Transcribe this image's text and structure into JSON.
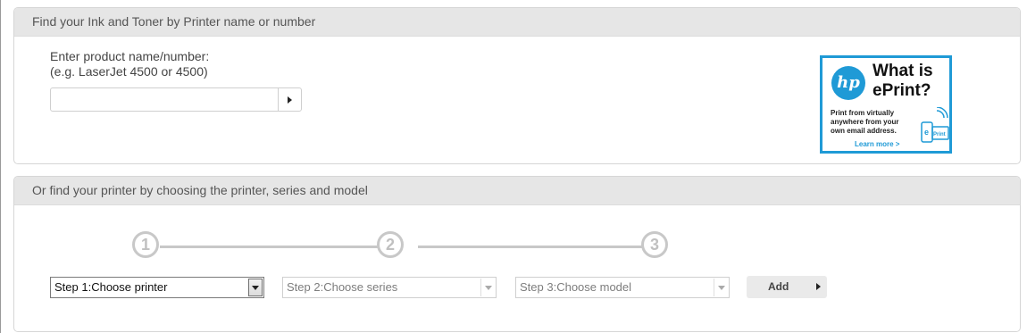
{
  "search_panel": {
    "title": "Find your Ink and Toner by Printer name or number",
    "label_line1": "Enter product name/number:",
    "label_line2": "(e.g. LaserJet 4500 or 4500)",
    "input_value": "",
    "input_placeholder": ""
  },
  "eprint_ad": {
    "logo_text": "hp",
    "headline_line1": "What is",
    "headline_line2": "ePrint?",
    "body_line1": "Print from virtually",
    "body_line2": "anywhere from your",
    "body_line3": "own email address.",
    "link": "Learn more >",
    "device_badge": "Print",
    "brand_color": "#1f9ad6"
  },
  "finder_panel": {
    "title": "Or find your printer by choosing the printer, series and model",
    "steps": [
      "1",
      "2",
      "3"
    ],
    "select1": "Step 1:Choose printer",
    "select2": "Step 2:Choose series",
    "select3": "Step 3:Choose model",
    "add_label": "Add"
  }
}
